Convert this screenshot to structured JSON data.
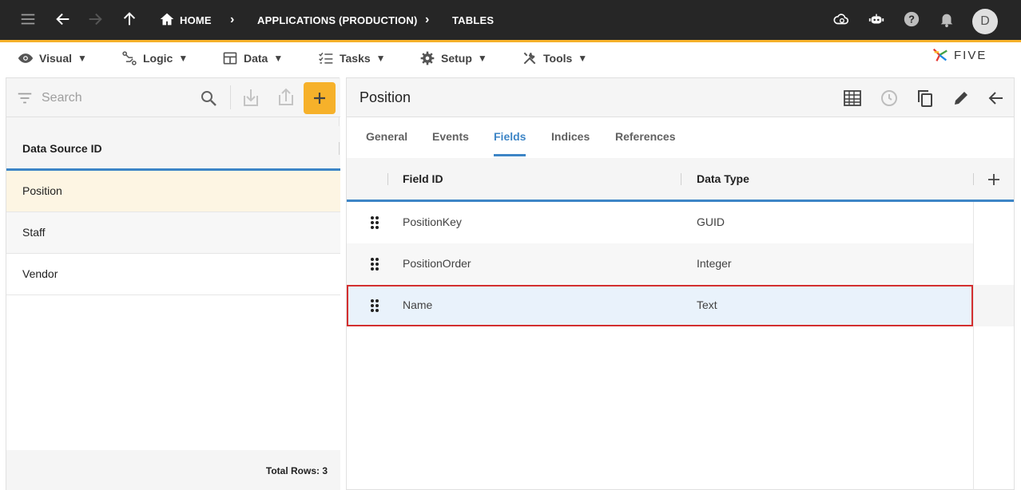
{
  "topbar": {
    "breadcrumbs": [
      "HOME",
      "APPLICATIONS (PRODUCTION)",
      "TABLES"
    ],
    "avatar_initial": "D"
  },
  "menu": {
    "items": [
      "Visual",
      "Logic",
      "Data",
      "Tasks",
      "Setup",
      "Tools"
    ],
    "caret": "▼"
  },
  "logo": {
    "text": "FIVE"
  },
  "left": {
    "search_placeholder": "Search",
    "add_label": "+",
    "column_header": "Data Source ID",
    "rows": [
      "Position",
      "Staff",
      "Vendor"
    ],
    "total_rows": "Total Rows: 3"
  },
  "right": {
    "title": "Position",
    "tabs": [
      "General",
      "Events",
      "Fields",
      "Indices",
      "References"
    ],
    "active_tab": "Fields",
    "columns": [
      "Field ID",
      "Data Type"
    ],
    "add_column_label": "+",
    "rows": [
      {
        "field_id": "PositionKey",
        "data_type": "GUID"
      },
      {
        "field_id": "PositionOrder",
        "data_type": "Integer"
      },
      {
        "field_id": "Name",
        "data_type": "Text"
      }
    ]
  },
  "colors": {
    "accent": "#f6b12a",
    "tab_active": "#3d85c6",
    "highlight_border": "#d32f2f",
    "topbar_bg": "#262626"
  },
  "icons": [
    "menu-icon",
    "back-arrow-icon",
    "forward-arrow-icon",
    "up-arrow-icon",
    "home-icon",
    "cloud-icon",
    "chatbot-icon",
    "help-icon",
    "bell-icon",
    "eye-icon",
    "logic-icon",
    "table-icon",
    "tasks-icon",
    "gear-icon",
    "tools-icon",
    "filter-icon",
    "search-icon",
    "import-icon",
    "export-icon",
    "grid-icon",
    "history-icon",
    "copy-icon",
    "edit-icon",
    "drag-handle-icon"
  ]
}
